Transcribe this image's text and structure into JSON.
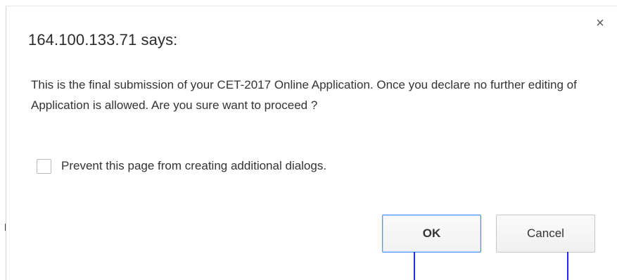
{
  "dialog": {
    "title": "164.100.133.71 says:",
    "close_symbol": "×",
    "message": "This is the final submission of your CET-2017 Online Application. Once you declare no further editing of Application is allowed. Are you sure want to proceed ?",
    "prevent_checkbox": {
      "label": "Prevent this page from creating additional dialogs.",
      "checked": false
    },
    "buttons": {
      "ok_label": "OK",
      "cancel_label": "Cancel"
    }
  },
  "icons": {
    "close": "close-icon"
  },
  "colors": {
    "ok_border": "#4d90fe",
    "marker_lines": "#1a2be0",
    "text": "#333333"
  }
}
